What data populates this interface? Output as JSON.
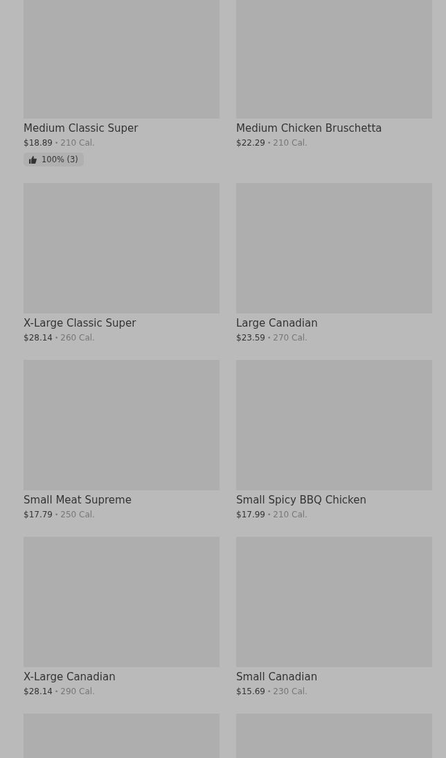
{
  "items": [
    {
      "kind": "full",
      "name": "Medium Classic Super",
      "price": "$18.89",
      "separator": "•",
      "calories": "210 Cal.",
      "rating": "100% (3)"
    },
    {
      "kind": "full",
      "name": "Medium Chicken Bruschetta",
      "price": "$22.29",
      "separator": "•",
      "calories": "210 Cal."
    },
    {
      "kind": "full",
      "name": "X-Large Classic Super",
      "price": "$28.14",
      "separator": "•",
      "calories": "260 Cal."
    },
    {
      "kind": "full",
      "name": "Large Canadian",
      "price": "$23.59",
      "separator": "•",
      "calories": "270 Cal."
    },
    {
      "kind": "full",
      "name": "Small Meat Supreme",
      "price": "$17.79",
      "separator": "•",
      "calories": "250 Cal."
    },
    {
      "kind": "full",
      "name": "Small Spicy BBQ Chicken",
      "price": "$17.99",
      "separator": "•",
      "calories": "210 Cal."
    },
    {
      "kind": "full",
      "name": "X-Large Canadian",
      "price": "$28.14",
      "separator": "•",
      "calories": "290 Cal."
    },
    {
      "kind": "full",
      "name": "Small Canadian",
      "price": "$15.69",
      "separator": "•",
      "calories": "230 Cal."
    },
    {
      "kind": "image_only"
    },
    {
      "kind": "image_only"
    }
  ]
}
